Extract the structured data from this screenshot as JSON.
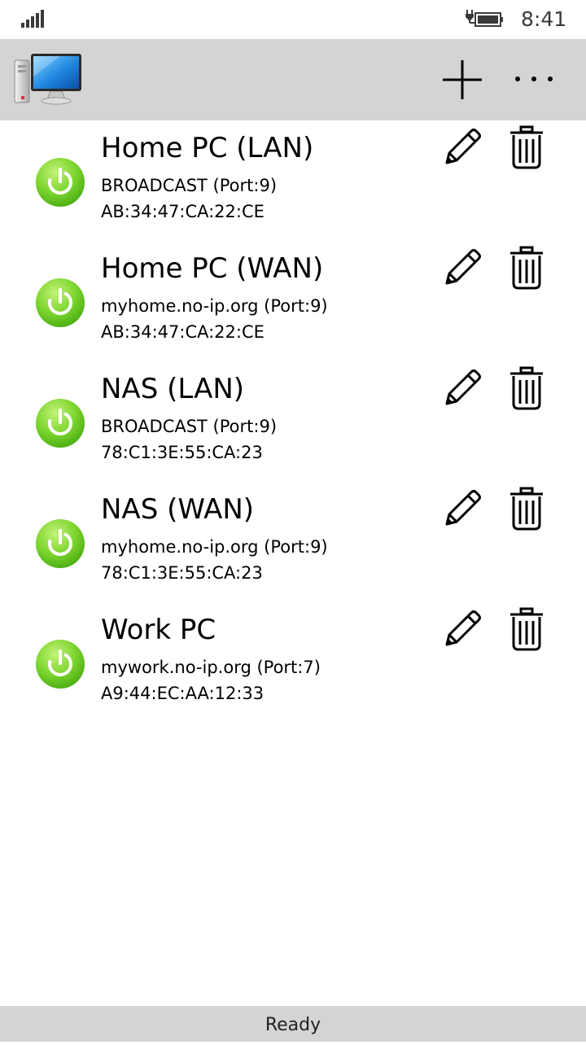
{
  "status_bar": {
    "time": "8:41",
    "signal_icon": "signal-strength-icon",
    "battery_icon": "battery-charging-icon"
  },
  "app_bar": {
    "logo_icon": "computer-monitor-icon",
    "add_icon": "plus-icon",
    "more_icon": "ellipsis-icon"
  },
  "devices": [
    {
      "name": "Home PC (LAN)",
      "host": "BROADCAST (Port:9)",
      "mac": "AB:34:47:CA:22:CE"
    },
    {
      "name": "Home PC (WAN)",
      "host": "myhome.no-ip.org (Port:9)",
      "mac": "AB:34:47:CA:22:CE"
    },
    {
      "name": "NAS (LAN)",
      "host": "BROADCAST (Port:9)",
      "mac": "78:C1:3E:55:CA:23"
    },
    {
      "name": "NAS (WAN)",
      "host": "myhome.no-ip.org (Port:9)",
      "mac": "78:C1:3E:55:CA:23"
    },
    {
      "name": "Work PC",
      "host": "mywork.no-ip.org (Port:7)",
      "mac": "A9:44:EC:AA:12:33"
    }
  ],
  "item_icons": {
    "power": "power-icon",
    "edit": "pencil-icon",
    "delete": "trash-icon"
  },
  "colors": {
    "app_bar_bg": "#d4d4d4",
    "power_green_light": "#9be34c",
    "power_green_dark": "#3fa60c"
  },
  "footer": {
    "status": "Ready"
  }
}
